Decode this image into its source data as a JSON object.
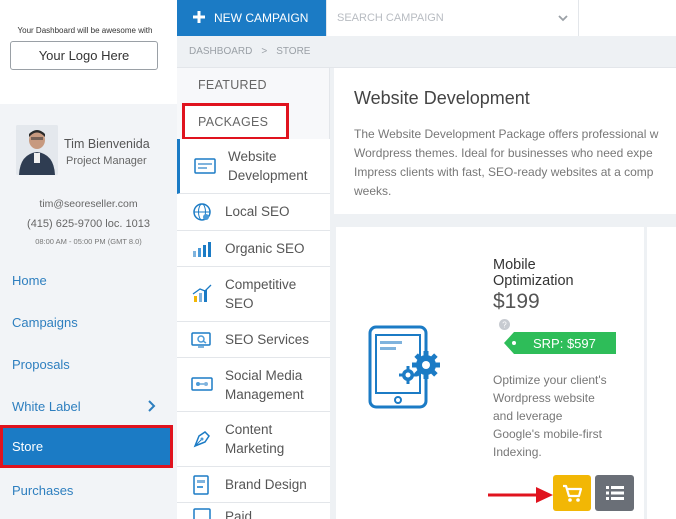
{
  "sidebar": {
    "tagline": "Your Dashboard will be awesome with",
    "logo_button": "Your Logo Here",
    "user": {
      "name": "Tim Bienvenida",
      "role": "Project Manager",
      "email": "tim@seoreseller.com",
      "phone": "(415) 625-9700 loc. 1013",
      "hours": "08:00 AM - 05:00 PM (GMT 8.0)"
    },
    "nav": {
      "home": "Home",
      "campaigns": "Campaigns",
      "proposals": "Proposals",
      "white_label": "White Label",
      "store": "Store",
      "purchases": "Purchases"
    }
  },
  "topbar": {
    "new_campaign": "NEW CAMPAIGN",
    "search_placeholder": "SEARCH CAMPAIGN"
  },
  "breadcrumb": {
    "root": "DASHBOARD",
    "separator": ">",
    "current": "STORE"
  },
  "categories": {
    "featured": "FEATURED",
    "packages": "PACKAGES",
    "items": [
      {
        "label": "Website Development",
        "lines": [
          "Website",
          "Development"
        ],
        "icon": "website-icon"
      },
      {
        "label": "Local SEO",
        "lines": [
          "Local SEO"
        ],
        "icon": "globe-icon"
      },
      {
        "label": "Organic SEO",
        "lines": [
          "Organic SEO"
        ],
        "icon": "bar-chart-icon"
      },
      {
        "label": "Competitive SEO",
        "lines": [
          "Competitive",
          "SEO"
        ],
        "icon": "rising-chart-icon"
      },
      {
        "label": "SEO Services",
        "lines": [
          "SEO Services"
        ],
        "icon": "monitor-search-icon"
      },
      {
        "label": "Social Media Management",
        "lines": [
          "Social Media",
          "Management"
        ],
        "icon": "social-screen-icon"
      },
      {
        "label": "Content Marketing",
        "lines": [
          "Content",
          "Marketing"
        ],
        "icon": "pen-nib-icon"
      },
      {
        "label": "Brand Design",
        "lines": [
          "Brand Design"
        ],
        "icon": "brand-card-icon"
      },
      {
        "label": "Paid",
        "lines": [
          "Paid"
        ],
        "icon": "paid-icon"
      }
    ]
  },
  "package": {
    "title": "Website Development",
    "description_lines": [
      "The Website Development Package offers professional w",
      "Wordpress themes. Ideal for businesses who need expe",
      "Impress clients with fast, SEO-ready websites at a comp",
      "weeks."
    ]
  },
  "product": {
    "title_lines": [
      "Mobile",
      "Optimization"
    ],
    "price": "$199",
    "srp": "SRP: $597",
    "description_lines": [
      "Optimize your client's",
      "Wordpress website",
      "and leverage",
      "Google's mobile-first",
      "Indexing."
    ]
  },
  "colors": {
    "brand_blue": "#1b7bc5",
    "highlight_red": "#e0131e",
    "srp_green": "#2ebd59",
    "cart_yellow": "#f2b705",
    "list_gray": "#6a6f77"
  }
}
